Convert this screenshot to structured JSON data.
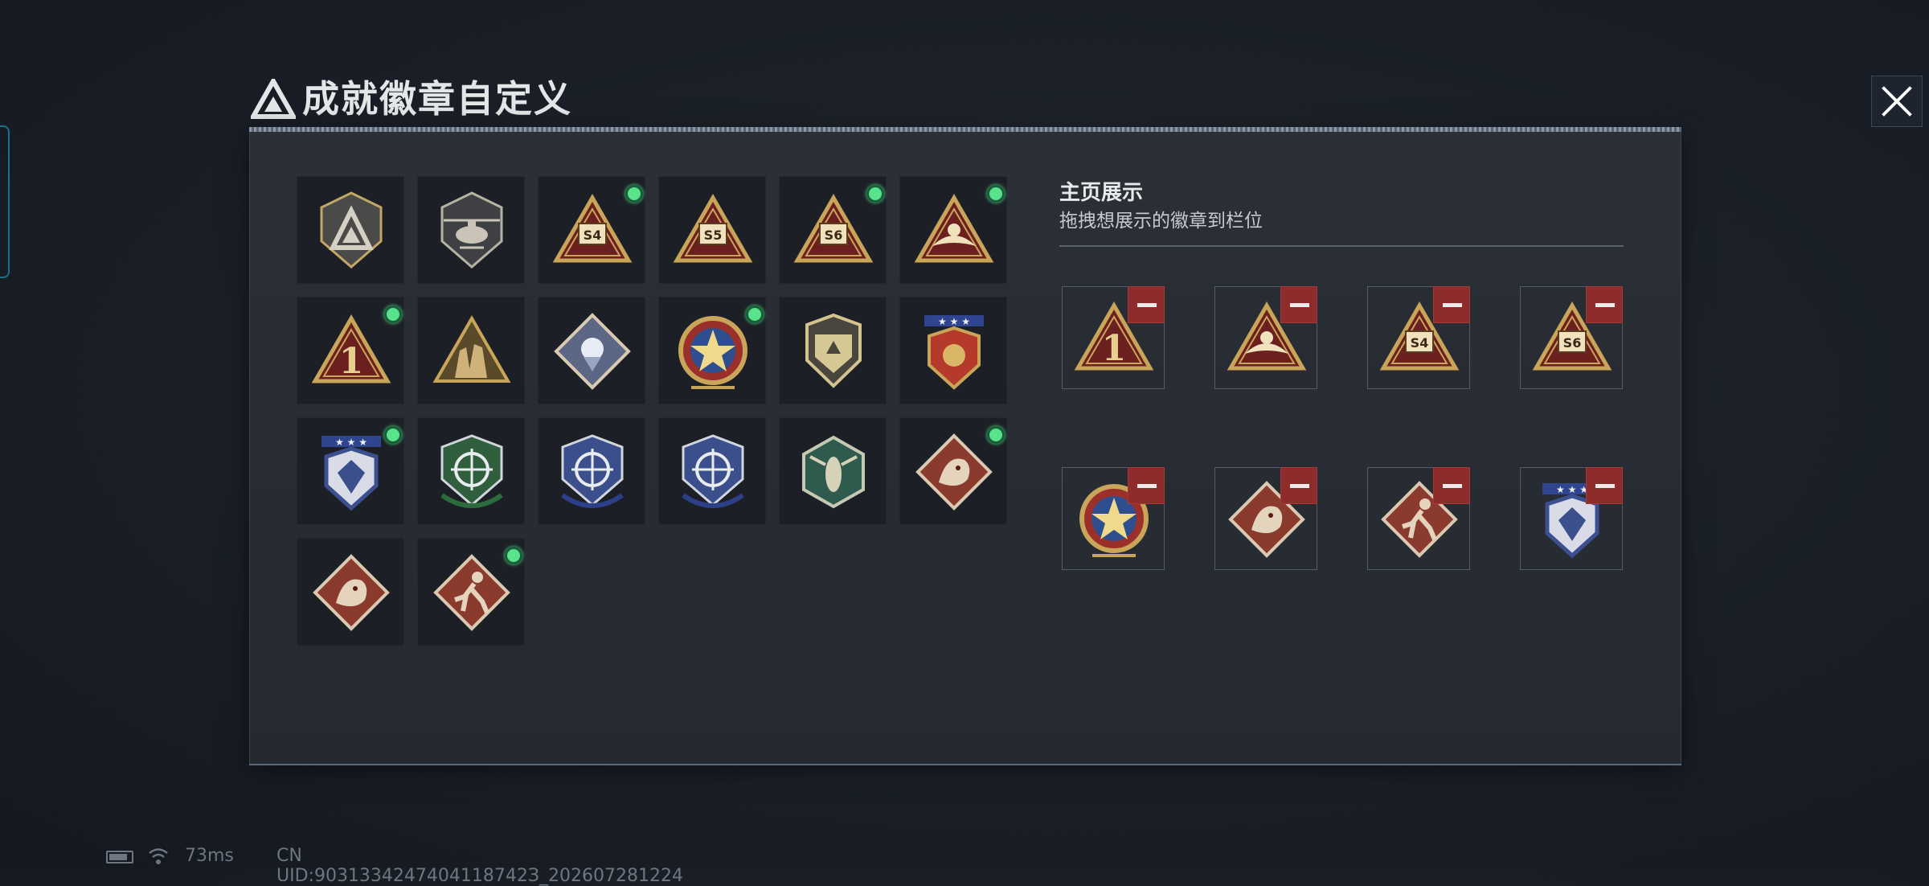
{
  "window": {
    "title": "成就徽章自定义",
    "close_icon": "close-icon",
    "title_icon": "triangle-logo-icon"
  },
  "badges": [
    {
      "name": "gray-shield-triangle-badge",
      "new": false
    },
    {
      "name": "helicopter-shield-badge",
      "new": false
    },
    {
      "name": "gold-s4-triangle-badge",
      "new": true
    },
    {
      "name": "gold-s5-triangle-badge",
      "new": false
    },
    {
      "name": "gold-s6-triangle-badge",
      "new": true
    },
    {
      "name": "gold-hand-triangle-badge",
      "new": true
    },
    {
      "name": "gold-number-one-triangle-badge",
      "new": true
    },
    {
      "name": "gold-soldiers-triangle-badge",
      "new": false
    },
    {
      "name": "blue-rose-diamond-badge",
      "new": false
    },
    {
      "name": "red-star-medal-badge",
      "new": true
    },
    {
      "name": "gold-wing-shield-badge",
      "new": false
    },
    {
      "name": "gold-wing-crest-stars-badge",
      "new": false
    },
    {
      "name": "blue-diamond-crest-badge",
      "new": true
    },
    {
      "name": "green-rifle-crosshair-badge",
      "new": false
    },
    {
      "name": "blue-rifle-crosshair-badge",
      "new": false
    },
    {
      "name": "blue-knife-crosshair-badge",
      "new": false
    },
    {
      "name": "green-hornet-hexagon-badge",
      "new": false
    },
    {
      "name": "red-dragon-diamond-badge",
      "new": true
    },
    {
      "name": "red-dragon-diamond-badge-2",
      "new": false
    },
    {
      "name": "red-runner-diamond-badge",
      "new": true
    }
  ],
  "showcase": {
    "title": "主页展示",
    "subtitle": "拖拽想展示的徽章到栏位",
    "remove_icon": "minus-icon",
    "slots": [
      {
        "badge": "gold-number-one-triangle-badge"
      },
      {
        "badge": "gold-hand-triangle-badge"
      },
      {
        "badge": "gold-s4-triangle-badge"
      },
      {
        "badge": "gold-s6-triangle-badge"
      },
      {
        "badge": "red-star-medal-badge"
      },
      {
        "badge": "red-dragon-diamond-badge"
      },
      {
        "badge": "red-runner-diamond-badge"
      },
      {
        "badge": "blue-diamond-crest-badge"
      }
    ]
  },
  "status_bar": {
    "battery_icon": "battery-icon",
    "wifi_icon": "wifi-icon",
    "ping": "73ms",
    "uid": "CN UID:9031334247404118742З_202607281224"
  },
  "colors": {
    "gold": "#c9a55a",
    "dark_red": "#6b1f1f",
    "badge_red": "#8a3b2e",
    "badge_blue": "#3a4f8c",
    "badge_green": "#2f5f3c",
    "new_dot": "#58e38c",
    "remove_button": "#8e2b2b"
  }
}
